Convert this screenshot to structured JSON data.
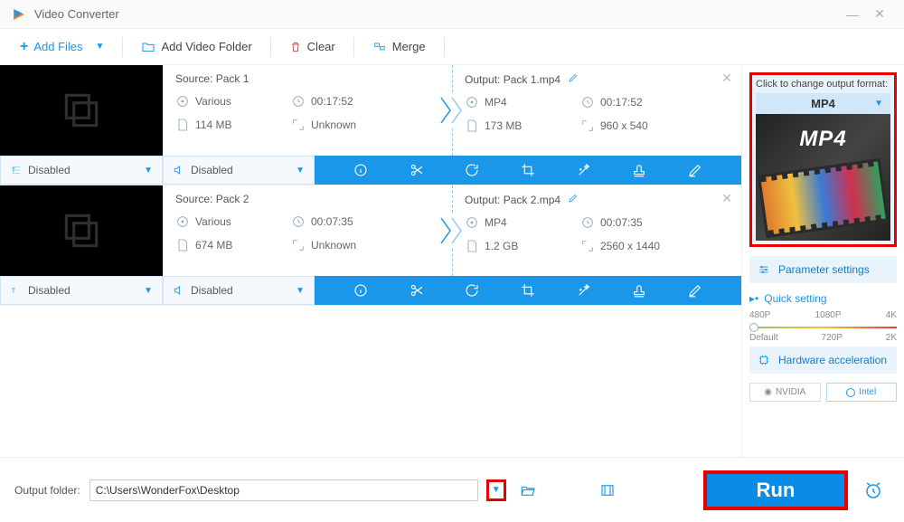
{
  "app": {
    "title": "Video Converter"
  },
  "toolbar": {
    "add_files": "Add Files",
    "add_folder": "Add Video Folder",
    "clear": "Clear",
    "merge": "Merge"
  },
  "items": [
    {
      "source_label": "Source: Pack 1",
      "src_format": "Various",
      "src_duration": "00:17:52",
      "src_size": "114 MB",
      "src_res": "Unknown",
      "output_label": "Output: Pack 1.mp4",
      "out_format": "MP4",
      "out_duration": "00:17:52",
      "out_size": "173 MB",
      "out_res": "960 x 540",
      "subtitle": "Disabled",
      "audio": "Disabled"
    },
    {
      "source_label": "Source: Pack 2",
      "src_format": "Various",
      "src_duration": "00:07:35",
      "src_size": "674 MB",
      "src_res": "Unknown",
      "output_label": "Output: Pack 2.mp4",
      "out_format": "MP4",
      "out_duration": "00:07:35",
      "out_size": "1.2 GB",
      "out_res": "2560 x 1440",
      "subtitle": "Disabled",
      "audio": "Disabled"
    }
  ],
  "side": {
    "change_format": "Click to change output format:",
    "format": "MP4",
    "format_badge": "MP4",
    "parameter": "Parameter settings",
    "quick": "Quick setting",
    "ticks_top": [
      "480P",
      "1080P",
      "4K"
    ],
    "ticks_bottom": [
      "Default",
      "720P",
      "2K"
    ],
    "hw": "Hardware acceleration",
    "nvidia": "NVIDIA",
    "intel": "Intel"
  },
  "bottom": {
    "label": "Output folder:",
    "path": "C:\\Users\\WonderFox\\Desktop",
    "run": "Run"
  }
}
